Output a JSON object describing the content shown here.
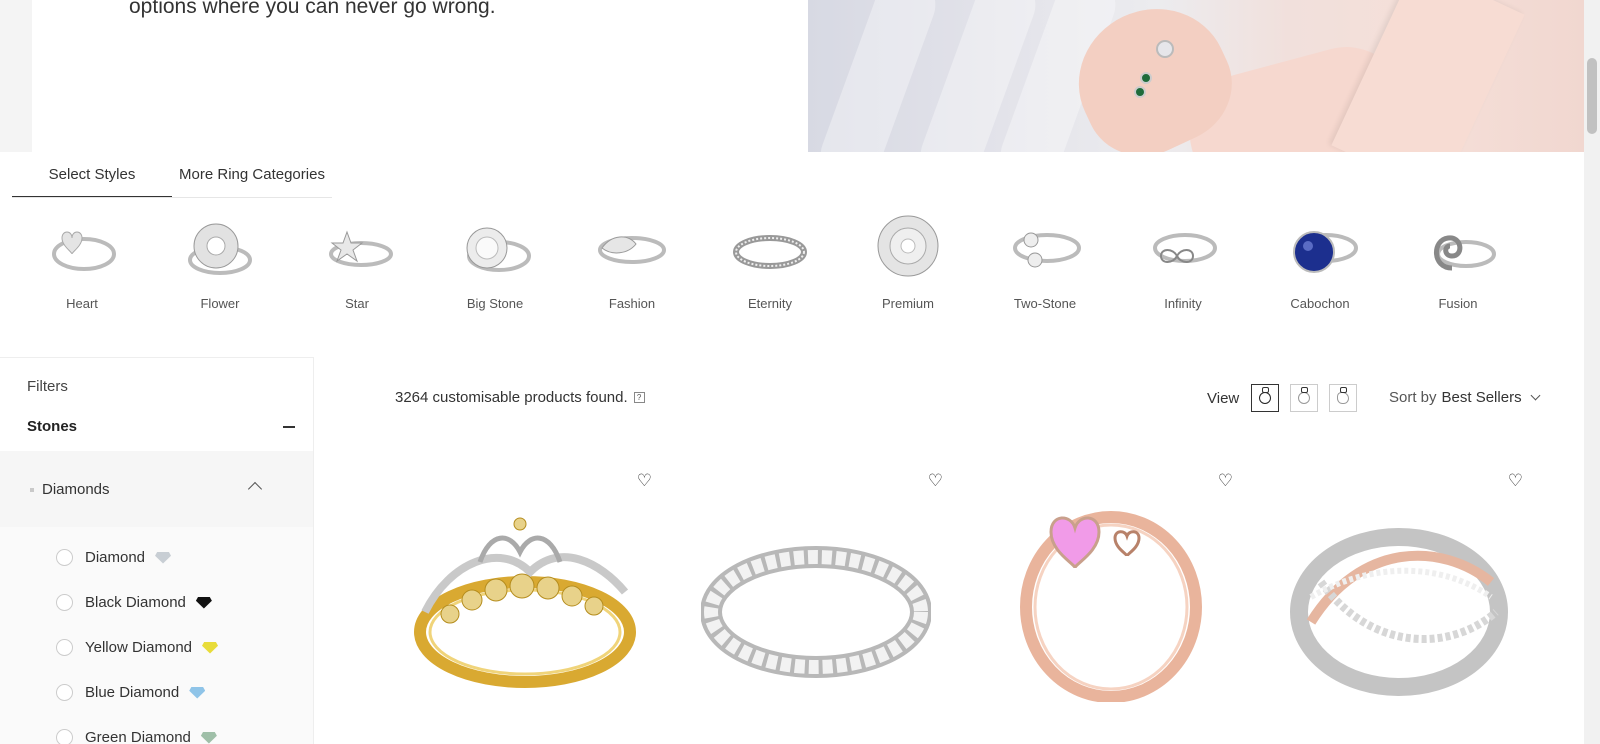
{
  "hero": {
    "text": "options where you can never go wrong."
  },
  "tabs": [
    {
      "label": "Select Styles",
      "active": true
    },
    {
      "label": "More Ring Categories",
      "active": false
    }
  ],
  "styles": [
    {
      "label": "Heart",
      "icon": "heart-ring-icon"
    },
    {
      "label": "Flower",
      "icon": "flower-ring-icon"
    },
    {
      "label": "Star",
      "icon": "star-ring-icon"
    },
    {
      "label": "Big Stone",
      "icon": "big-stone-ring-icon"
    },
    {
      "label": "Fashion",
      "icon": "fashion-ring-icon"
    },
    {
      "label": "Eternity",
      "icon": "eternity-ring-icon"
    },
    {
      "label": "Premium",
      "icon": "premium-ring-icon"
    },
    {
      "label": "Two-Stone",
      "icon": "two-stone-ring-icon"
    },
    {
      "label": "Infinity",
      "icon": "infinity-ring-icon"
    },
    {
      "label": "Cabochon",
      "icon": "cabochon-ring-icon"
    },
    {
      "label": "Fusion",
      "icon": "fusion-ring-icon"
    }
  ],
  "sidebar": {
    "filters_label": "Filters",
    "stones_label": "Stones",
    "diamonds_label": "Diamonds",
    "stones": [
      {
        "name": "Diamond",
        "color": "#d8dde2"
      },
      {
        "name": "Black Diamond",
        "color": "#111111"
      },
      {
        "name": "Yellow Diamond",
        "color": "#e8dc3a"
      },
      {
        "name": "Blue Diamond",
        "color": "#8fc4e8"
      },
      {
        "name": "Green Diamond",
        "color": "#9fbfa8"
      }
    ]
  },
  "results": {
    "count_text": "3264 customisable products found.",
    "help_glyph": "?",
    "view_label": "View",
    "sort_prefix": "Sort by",
    "sort_value": "Best Sellers"
  },
  "products": [
    {
      "name": "tiara-ring",
      "metal": "gold"
    },
    {
      "name": "eternity-band",
      "metal": "white-gold"
    },
    {
      "name": "pink-heart-ring",
      "metal": "rose-gold"
    },
    {
      "name": "crossover-ring",
      "metal": "two-tone"
    }
  ],
  "colors": {
    "accent_text": "#333333",
    "sidebar_bg": "#f6f6f6"
  }
}
